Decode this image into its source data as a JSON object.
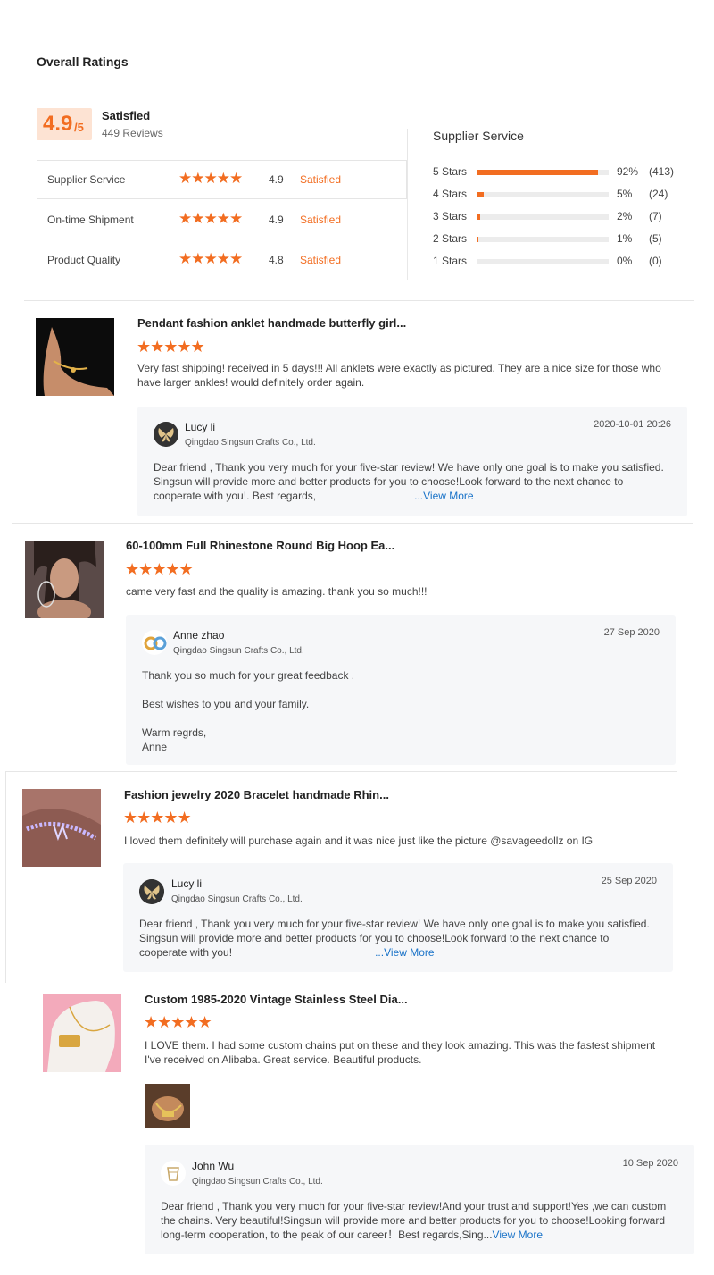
{
  "title": "Overall Ratings",
  "summary": {
    "score": "4.9",
    "out_of": "/5",
    "label": "Satisfied",
    "reviews": "449 Reviews"
  },
  "metrics": [
    {
      "label": "Supplier Service",
      "stars": "★★★★★",
      "score": "4.9",
      "status": "Satisfied"
    },
    {
      "label": "On-time Shipment",
      "stars": "★★★★★",
      "score": "4.9",
      "status": "Satisfied"
    },
    {
      "label": "Product Quality",
      "stars": "★★★★★",
      "score": "4.8",
      "status": "Satisfied"
    }
  ],
  "distribution": {
    "title": "Supplier Service",
    "rows": [
      {
        "label": "5 Stars",
        "fraction": 0.92,
        "pct": "92%",
        "count": "(413)"
      },
      {
        "label": "4 Stars",
        "fraction": 0.05,
        "pct": "5%",
        "count": "(24)"
      },
      {
        "label": "3 Stars",
        "fraction": 0.02,
        "pct": "2%",
        "count": "(7)"
      },
      {
        "label": "2 Stars",
        "fraction": 0.01,
        "pct": "1%",
        "count": "(5)"
      },
      {
        "label": "1 Stars",
        "fraction": 0.0,
        "pct": "0%",
        "count": "(0)"
      }
    ]
  },
  "colors": {
    "accent": "#f26d21",
    "link": "#1a73c8",
    "reply_bg": "#f6f7f9"
  },
  "reviews": [
    {
      "product": "Pendant fashion anklet handmade butterfly girl...",
      "rating": 5,
      "stars": "★★★★★",
      "text": "Very fast shipping! received in 5 days!!! All anklets were exactly as pictured. They are a nice size for those who have larger ankles! would definitely order again.",
      "reply": {
        "name": "Lucy li",
        "company": "Qingdao Singsun Crafts Co., Ltd.",
        "date": "2020-10-01 20:26",
        "lines": [
          "Dear friend , Thank you very much for your five-star review! We have only one goal is to make you satisfied.",
          "Singsun will provide more and better products for you to choose!Look forward to the next chance to",
          "cooperate with you!.   Best regards,"
        ],
        "view_more": "...View More"
      }
    },
    {
      "product": "60-100mm Full Rhinestone Round Big Hoop Ea...",
      "rating": 5,
      "stars": "★★★★★",
      "text": "came very fast and the quality is amazing. thank you so much!!!",
      "reply": {
        "name": "Anne zhao",
        "company": "Qingdao Singsun Crafts Co., Ltd.",
        "date": "27 Sep 2020",
        "lines": [
          "Thank you so much for your great feedback .",
          "Best wishes to you and your family.",
          "Warm regrds,",
          "Anne"
        ]
      }
    },
    {
      "product": "Fashion jewelry 2020 Bracelet handmade Rhin...",
      "rating": 5,
      "stars": "★★★★★",
      "text": "I loved them definitely will purchase again and it was nice just like the picture @savageedollz on IG",
      "reply": {
        "name": "Lucy li",
        "company": "Qingdao Singsun Crafts Co., Ltd.",
        "date": "25 Sep 2020",
        "lines": [
          "Dear friend , Thank you very much for your five-star review! We have only one goal is to make you satisfied.",
          "Singsun will provide more and better products for you to choose!Look forward to the next chance to",
          "cooperate with you!"
        ],
        "view_more": "...View More"
      }
    },
    {
      "product": "Custom 1985-2020 Vintage Stainless Steel Dia...",
      "rating": 5,
      "stars": "★★★★★",
      "text": "I LOVE them. I had some custom chains put on these and they look amazing. This was the fastest shipment I've received on Alibaba. Great service. Beautiful products.",
      "reply": {
        "name": "John Wu",
        "company": "Qingdao Singsun Crafts Co., Ltd.",
        "date": "10 Sep 2020",
        "lines": [
          "Dear friend , Thank you very much for your five-star review!And your trust and support!Yes ,we can custom",
          "the chains. Very beautiful!Singsun will provide more and better products for you to choose!Looking forward",
          "long-term cooperation, to the peak of our career！Best regards,Sing..."
        ],
        "view_more": "View More"
      }
    }
  ]
}
